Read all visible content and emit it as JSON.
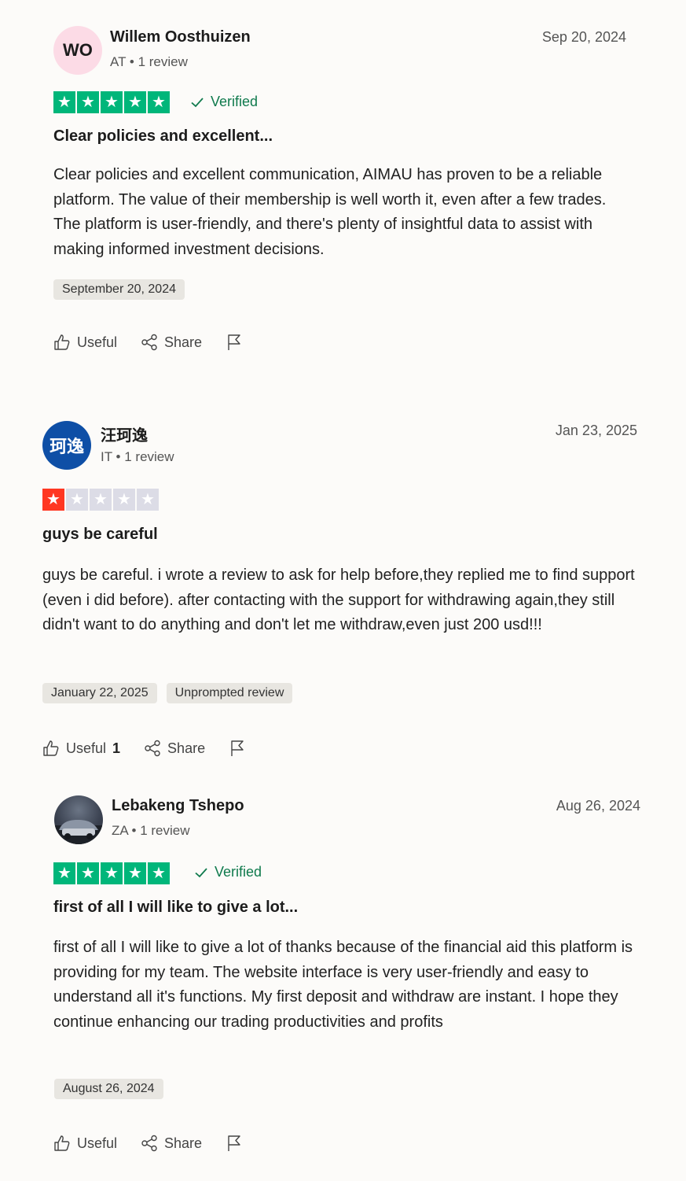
{
  "reviews": [
    {
      "avatar_text": "WO",
      "name": "Willem Oosthuizen",
      "country": "AT",
      "review_count": "1 review",
      "date": "Sep 20, 2024",
      "rating": 5,
      "verified_label": "Verified",
      "title": "Clear policies and excellent...",
      "body": "Clear policies and excellent communication, AIMAU has proven to be a reliable platform. The value of their membership is well worth it, even after a few trades. The platform is user-friendly, and there's plenty of insightful data to assist with making informed investment decisions.",
      "experience_date": "September 20, 2024",
      "useful_label": "Useful",
      "share_label": "Share"
    },
    {
      "avatar_text": "珂逸",
      "name": "汪珂逸",
      "country": "IT",
      "review_count": "1 review",
      "date": "Jan 23, 2025",
      "rating": 1,
      "title": "guys be careful",
      "body": "guys be careful. i wrote a review to ask for help before,they replied me to find support (even i did before). after contacting with the support for withdrawing again,they still didn't want to do anything and don't let me withdraw,even just 200 usd!!!",
      "experience_date": "January 22, 2025",
      "extra_tag": "Unprompted review",
      "useful_label": "Useful",
      "useful_count": "1",
      "share_label": "Share"
    },
    {
      "name": "Lebakeng Tshepo",
      "country": "ZA",
      "review_count": "1 review",
      "date": "Aug 26, 2024",
      "rating": 5,
      "verified_label": "Verified",
      "title": "first of all I will like to give a lot...",
      "body": "first of all I will like to give a lot of thanks because of the financial aid this platform is providing for my team. The website interface is very user-friendly and easy to understand all it's functions. My first deposit and withdraw are instant. I hope they continue enhancing our trading productivities and profits",
      "experience_date": "August 26, 2024",
      "useful_label": "Useful",
      "share_label": "Share"
    }
  ],
  "separator": "•",
  "colors": {
    "star_green": "#00b67a",
    "star_red": "#ff3722",
    "star_empty": "#dcdce6",
    "verified": "#0f7a4d"
  }
}
